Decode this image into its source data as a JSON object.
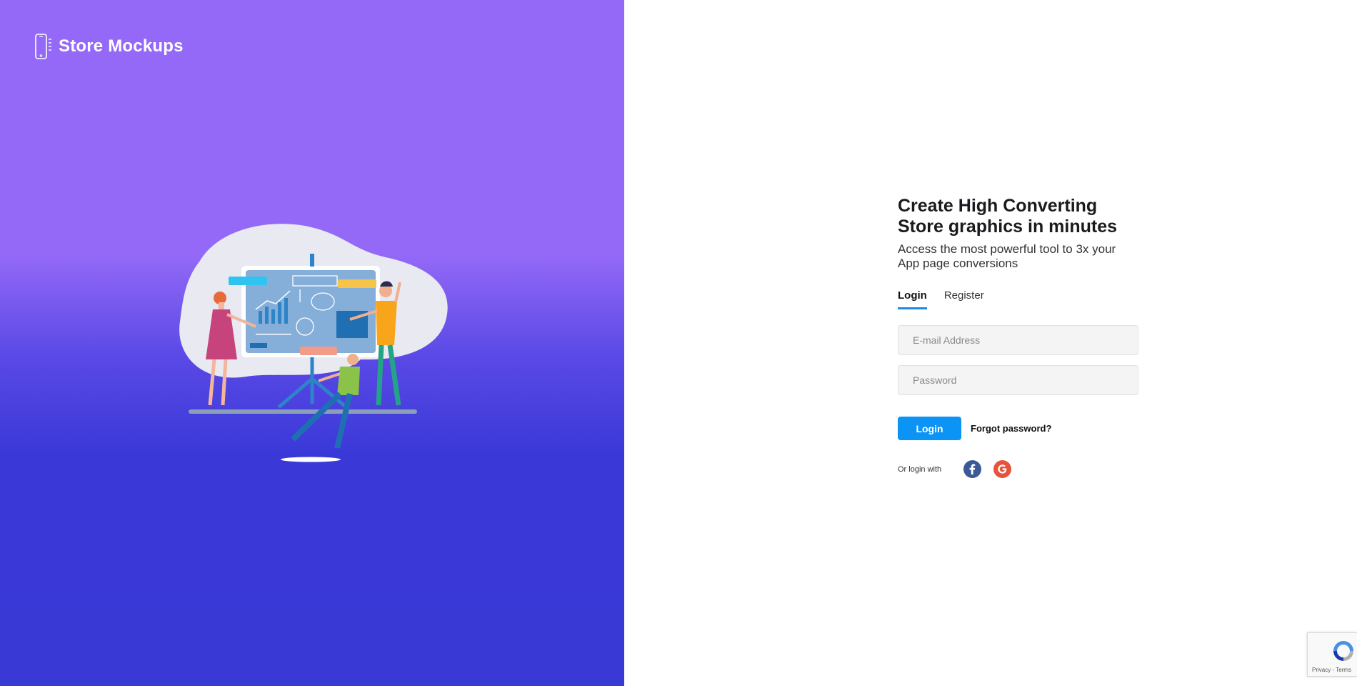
{
  "brand": {
    "name": "Store Mockups",
    "icon": "phone-icon"
  },
  "hero": {
    "illustration": "presentation-illustration"
  },
  "form": {
    "headline": "Create High Converting Store graphics in minutes",
    "subhead": "Access the most powerful tool to 3x your App page conversions",
    "tabs": [
      {
        "label": "Login",
        "active": true
      },
      {
        "label": "Register",
        "active": false
      }
    ],
    "email_placeholder": "E-mail Address",
    "password_placeholder": "Password",
    "login_button": "Login",
    "forgot_link": "Forgot password?",
    "social_label": "Or login with",
    "social": [
      {
        "name": "facebook-icon",
        "color": "#3b5998"
      },
      {
        "name": "google-icon",
        "color": "#e5533d"
      }
    ]
  },
  "recaptcha": {
    "links": "Privacy - Terms"
  },
  "colors": {
    "gradient_top": "#9469f7",
    "gradient_bottom": "#3939d6",
    "accent": "#0b93f6",
    "tab_underline": "#1e88e5"
  }
}
